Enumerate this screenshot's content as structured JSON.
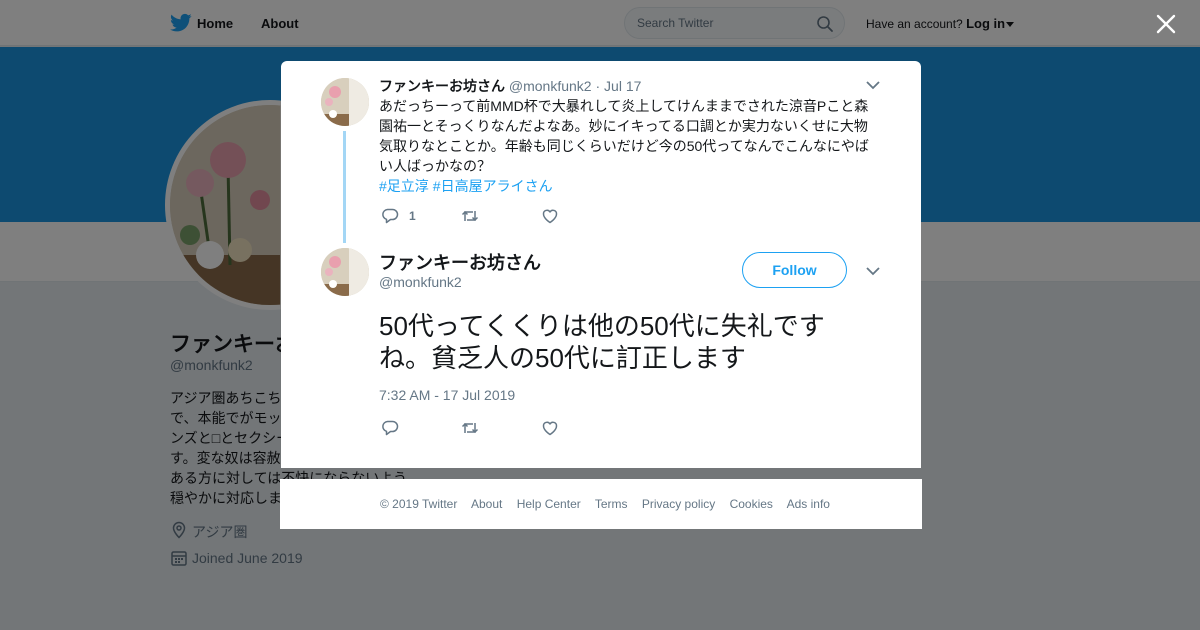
{
  "topbar": {
    "home_label": "Home",
    "about_label": "About",
    "search_placeholder": "Search Twitter",
    "account_prompt": "Have an account?",
    "login_label": "Log in"
  },
  "profile": {
    "name": "ファンキーお坊さん",
    "handle": "@monkfunk2",
    "bio_lines": [
      "アジア圏あちこち",
      "で、本能でがモッ",
      "ンズと□とセクシー",
      "す。変な奴は容赦",
      "ある方に対しては不快にならないよう",
      "穏やかに対応しま"
    ],
    "location": "アジア圏",
    "joined": "Joined June 2019"
  },
  "tweet_parent": {
    "name": "ファンキーお坊さん",
    "handle": "@monkfunk2",
    "date": "· Jul 17",
    "text": "あだっちーって前MMD杯で大暴れして炎上してけんままでされた涼音Pこと森園祐一とそっくりなんだよなあ。妙にイキってる口調とか実力ないくせに大物気取りなとことか。年齢も同じくらいだけど今の50代ってなんでこんなにやばい人ばっかなの？",
    "hashtags": [
      "#足立淳",
      "#日高屋アライさん"
    ],
    "reply_count": "1"
  },
  "tweet_main": {
    "name": "ファンキーお坊さん",
    "handle": "@monkfunk2",
    "follow_label": "Follow",
    "text": "50代ってくくりは他の50代に失礼ですね。貧乏人の50代に訂正します",
    "timestamp": "7:32 AM - 17 Jul 2019"
  },
  "footer": {
    "links": [
      "© 2019 Twitter",
      "About",
      "Help Center",
      "Terms",
      "Privacy policy",
      "Cookies",
      "Ads info"
    ]
  },
  "colors": {
    "accent": "#1da1f2",
    "banner": "#1b95e0",
    "muted": "#657786"
  },
  "icons": [
    "twitter-bird-icon",
    "search-icon",
    "close-icon",
    "reply-icon",
    "retweet-icon",
    "like-icon",
    "chevron-down-icon",
    "location-icon",
    "calendar-icon"
  ]
}
